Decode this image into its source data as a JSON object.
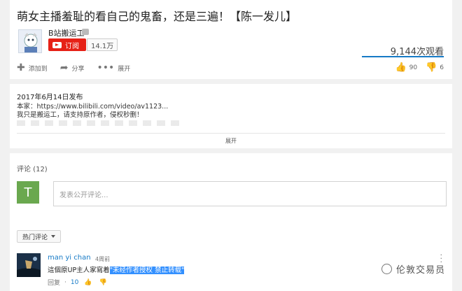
{
  "video": {
    "title": "萌女主播羞耻的看自己的鬼畜，还是三遍！【陈一发儿】",
    "channel_name": "B站搬运工",
    "subscribe_label": "订阅",
    "subscriber_count": "14.1万",
    "views": "9,144次观看",
    "actions": {
      "add_to": "添加到",
      "share": "分享",
      "more": "展开"
    },
    "likes": "90",
    "dislikes": "6"
  },
  "description": {
    "published": "2017年6月14日发布",
    "line1": "本家：https://www.bilibili.com/video/av1123...",
    "line2": "我只是搬运工，请支持原作者，侵权秒删！",
    "expand_label": "展开"
  },
  "comments": {
    "count_label": "评论 (12)",
    "user_initial": "T",
    "input_placeholder": "发表公开评论...",
    "sort_label": "热门评论",
    "items": [
      {
        "author": "man yi chan",
        "time": "4周前",
        "text_prefix": "這個原UP主人家寫着",
        "text_highlight": "\"未经作者授权 禁止转载\"",
        "reply_label": "回复",
        "separator": "·",
        "likes": "10"
      }
    ]
  },
  "watermark": "伦敦交易员",
  "colors": {
    "accent": "#167ac6",
    "subscribe": "#e62117",
    "avatar_green": "#6aa84f",
    "highlight": "#3390ff"
  }
}
